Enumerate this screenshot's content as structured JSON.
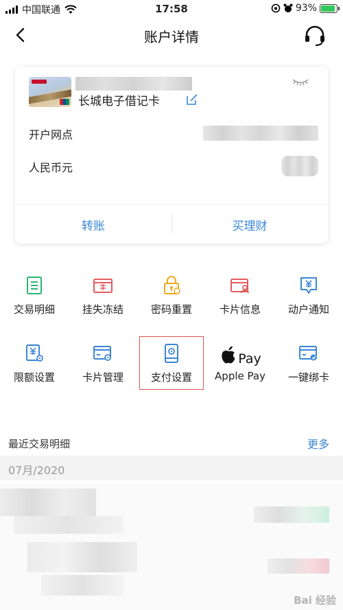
{
  "status_bar": {
    "carrier": "中国联通",
    "time": "17:58",
    "battery": "93%",
    "battery_level": 0.93
  },
  "nav": {
    "title": "账户详情"
  },
  "card": {
    "name": "长城电子借记卡",
    "branch_label": "开户网点",
    "currency_label": "人民币元",
    "transfer_label": "转账",
    "wealth_label": "买理财"
  },
  "functions": [
    {
      "label": "交易明细",
      "icon": "transaction-detail-icon",
      "color": "#2bb673"
    },
    {
      "label": "挂失冻结",
      "icon": "loss-report-icon",
      "color": "#e35b5b"
    },
    {
      "label": "密码重置",
      "icon": "password-lock-icon",
      "color": "#f2a81d"
    },
    {
      "label": "卡片信息",
      "icon": "card-info-icon",
      "color": "#e35b5b"
    },
    {
      "label": "动户通知",
      "icon": "account-notice-icon",
      "color": "#3a86d6"
    },
    {
      "label": "限额设置",
      "icon": "limit-setting-icon",
      "color": "#3a86d6"
    },
    {
      "label": "卡片管理",
      "icon": "card-manage-icon",
      "color": "#3a86d6"
    },
    {
      "label": "支付设置",
      "icon": "payment-setting-icon",
      "color": "#3a86d6"
    },
    {
      "label": "Apple Pay",
      "icon": "apple-pay-icon",
      "logo_text": "Pay",
      "color": "#111111"
    },
    {
      "label": "一键绑卡",
      "icon": "bind-card-icon",
      "color": "#3a86d6"
    }
  ],
  "recent": {
    "title": "最近交易明细",
    "more": "更多",
    "month": "07月/2020"
  },
  "watermark": "Bai 经验",
  "colors": {
    "accent": "#3a86d6",
    "highlight_border": "#d9534f"
  }
}
